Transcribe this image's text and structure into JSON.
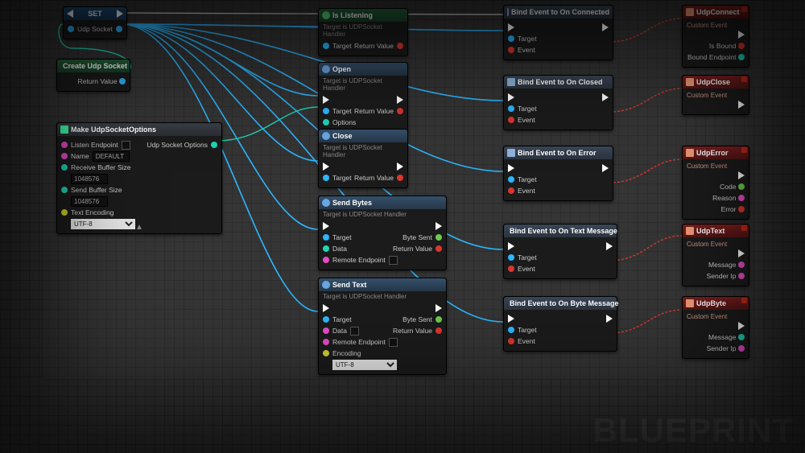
{
  "watermark": "BLUEPRINT",
  "encoding_option": "UTF-8",
  "set": {
    "title": "SET",
    "pin": "Udp Socket"
  },
  "createSocket": {
    "title": "Create Udp Socket",
    "out": "Return Value"
  },
  "makeOptions": {
    "title": "Make UdpSocketOptions",
    "listenEndpoint": "Listen Endpoint",
    "name": "Name",
    "nameValue": "DEFAULT",
    "rbuf": "Receive Buffer Size",
    "rbufValue": "1048576",
    "sbuf": "Send Buffer Size",
    "sbufValue": "1048576",
    "enc": "Text Encoding",
    "out": "Udp Socket Options"
  },
  "targetSub": "Target is UDPSocket Handler",
  "isListening": {
    "title": "Is Listening",
    "target": "Target",
    "ret": "Return Value"
  },
  "open": {
    "title": "Open",
    "target": "Target",
    "options": "Options",
    "ret": "Return Value"
  },
  "close": {
    "title": "Close",
    "target": "Target",
    "ret": "Return Value"
  },
  "sendBytes": {
    "title": "Send Bytes",
    "target": "Target",
    "data": "Data",
    "remote": "Remote Endpoint",
    "byteSent": "Byte Sent",
    "ret": "Return Value"
  },
  "sendText": {
    "title": "Send Text",
    "target": "Target",
    "data": "Data",
    "remote": "Remote Endpoint",
    "enc": "Encoding",
    "byteSent": "Byte Sent",
    "ret": "Return Value"
  },
  "binds": {
    "connected": "Bind Event to On Connected",
    "closed": "Bind Event to On Closed",
    "error": "Bind Event to On Error",
    "text": "Bind Event to On Text Message",
    "byte": "Bind Event to On Byte Message",
    "target": "Target",
    "event": "Event"
  },
  "events": {
    "sub": "Custom Event",
    "connect": {
      "title": "UdpConnect",
      "p1": "Is Bound",
      "p2": "Bound Endpoint"
    },
    "close": {
      "title": "UdpClose"
    },
    "error": {
      "title": "UdpError",
      "p1": "Code",
      "p2": "Reason",
      "p3": "Error"
    },
    "text": {
      "title": "UdpText",
      "p1": "Message",
      "p2": "Sender Ip"
    },
    "byte": {
      "title": "UdpByte",
      "p1": "Message",
      "p2": "Sender Ip"
    }
  }
}
